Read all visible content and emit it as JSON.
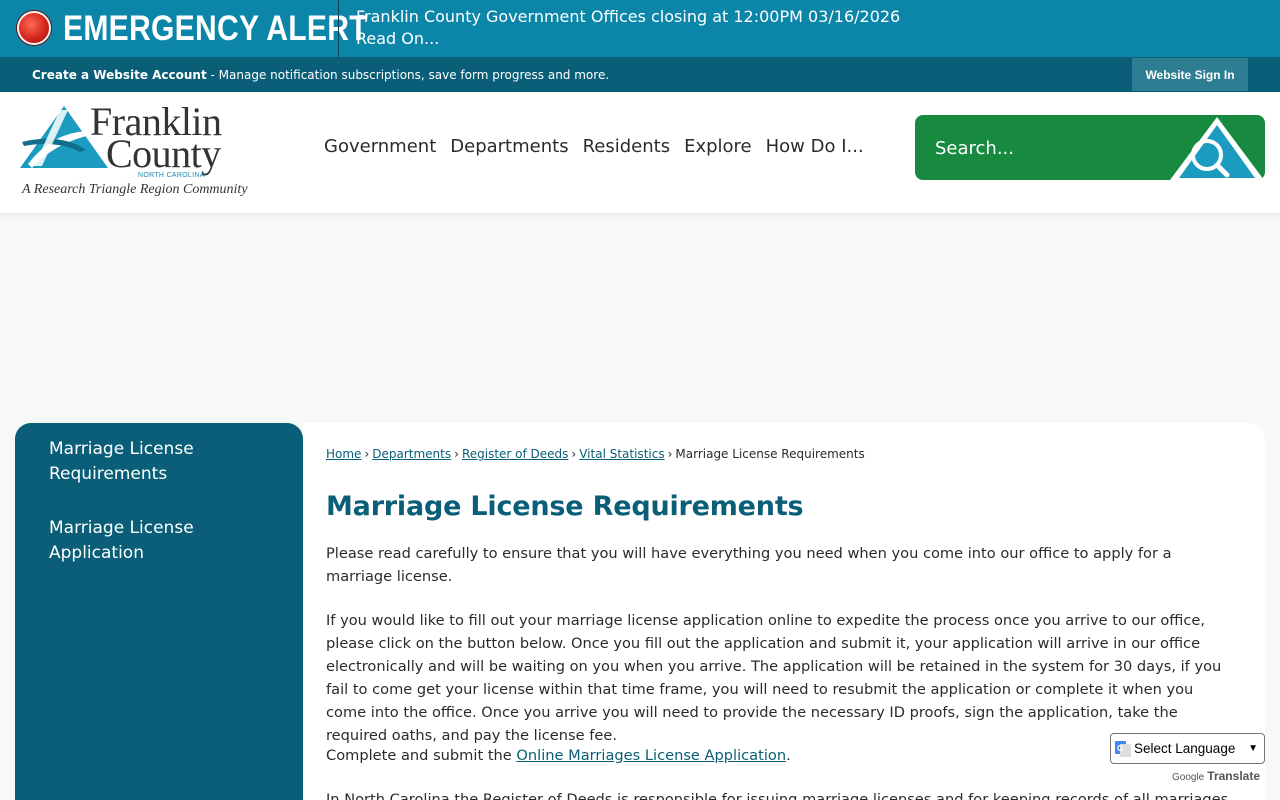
{
  "alert": {
    "title": "EMERGENCY ALERT",
    "message_line1": "Franklin County Government Offices closing at 12:00PM 03/16/2026",
    "message_line2": "Read On..."
  },
  "account_bar": {
    "create_label": "Create a Website Account",
    "create_desc": " - Manage notification subscriptions, save form progress and more.",
    "signin_label": "Website Sign In"
  },
  "logo": {
    "name_line1": "Franklin",
    "name_line2": "County",
    "state": "NORTH CAROLINA",
    "tagline": "A Research Triangle Region Community"
  },
  "nav": {
    "items": [
      "Government",
      "Departments",
      "Residents",
      "Explore",
      "How Do I..."
    ]
  },
  "search": {
    "placeholder": "Search..."
  },
  "sidebar": {
    "items": [
      {
        "label": "Marriage License Requirements"
      },
      {
        "label": "Marriage License Application"
      }
    ]
  },
  "breadcrumb": {
    "links": [
      "Home",
      "Departments",
      "Register of Deeds",
      "Vital Statistics"
    ],
    "current": "Marriage License Requirements"
  },
  "main": {
    "title": "Marriage License Requirements",
    "para1": "Please read carefully to ensure that you will have everything you need when you come into our office to apply for a marriage license.",
    "para2": "If you would like to fill out your marriage license application online to expedite the process once you arrive to our office, please click on the button below. Once you fill out the application and submit it, your application will arrive in our office electronically and will be waiting on you when you arrive. The application will be retained in the system for 30 days, if you fail to come get your license within that time frame, you will need to resubmit the application or complete it when you come into the office. Once you arrive you will need to provide the necessary ID proofs, sign the application, take the required oaths, and pay the license fee.",
    "para3_prefix": "Complete and submit the ",
    "para3_link": "Online Marriages License Application",
    "para3_suffix": ".",
    "para4": "In North Carolina the Register of Deeds is responsible for issuing marriage licenses and for keeping records of all marriages"
  },
  "translate": {
    "select_label": "Select Language",
    "powered_by": "Google",
    "translate_label": "Translate"
  },
  "colors": {
    "alert_bg": "#0b86a8",
    "dark_teal": "#0a5e77",
    "search_green": "#178a3f"
  }
}
